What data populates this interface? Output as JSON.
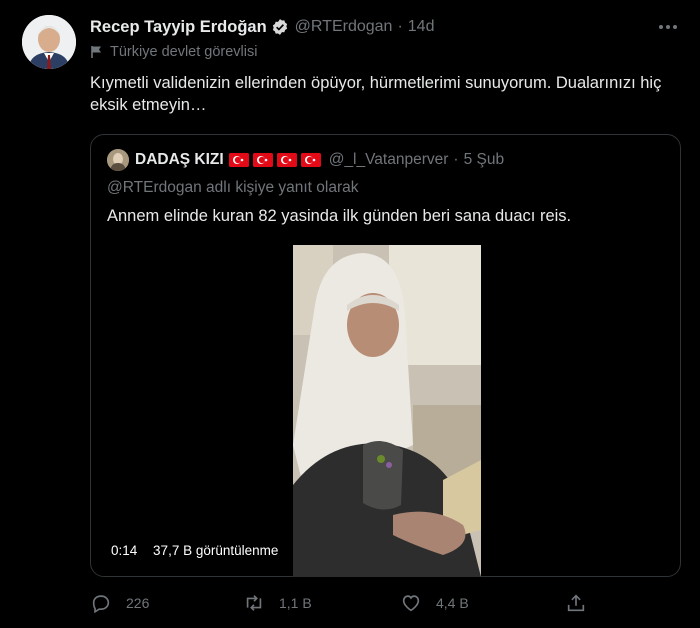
{
  "author": {
    "name": "Recep Tayyip Erdoğan",
    "handle": "@RTErdogan",
    "time": "14d",
    "label": "Türkiye devlet görevlisi"
  },
  "separator": "·",
  "tweet_text": "Kıymetli validenizin ellerinden öpüyor, hürmetlerimi sunuyorum. Dualarınızı hiç eksik etmeyin…",
  "quote": {
    "name": "DADAŞ KIZI",
    "handle": "@_l_Vatanperver",
    "time": "5 Şub",
    "reply_to": "@RTErdogan adlı kişiye yanıt olarak",
    "text": "Annem elinde kuran 82 yasinda ilk günden beri sana duacı reis.",
    "video": {
      "duration": "0:14",
      "views": "37,7 B görüntülenme"
    }
  },
  "actions": {
    "replies": "226",
    "retweets": "1,1 B",
    "likes": "4,4 B"
  },
  "colors": {
    "background": "#000000",
    "text": "#e7e9ea",
    "muted": "#71767b",
    "border": "#2f3336",
    "verified": "#d9d9d9",
    "flag": "#e30a17"
  },
  "icons": [
    "verified-icon",
    "more-icon",
    "flag-label-icon",
    "reply-icon",
    "retweet-icon",
    "like-icon",
    "share-icon"
  ]
}
